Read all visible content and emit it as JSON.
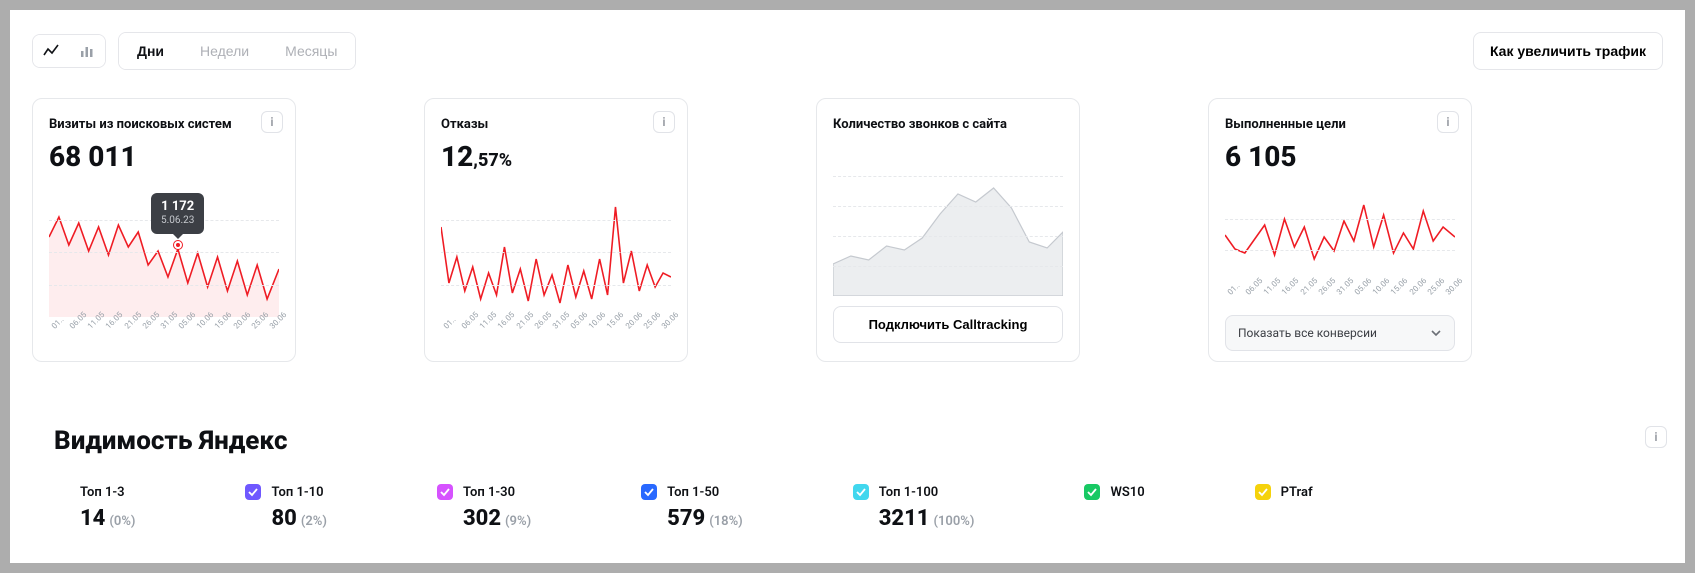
{
  "toolbar": {
    "chart_type": {
      "line_active": true,
      "bar_active": false
    },
    "periods": {
      "days": {
        "label": "Дни",
        "active": true
      },
      "weeks": {
        "label": "Недели",
        "active": false
      },
      "months": {
        "label": "Месяцы",
        "active": false
      }
    },
    "cta_label": "Как увеличить трафик"
  },
  "cards": {
    "visits": {
      "title": "Визиты из поисковых систем",
      "value": "68 011",
      "tooltip": {
        "value": "1 172",
        "date": "5.06.23"
      },
      "x_ticks": [
        "01..",
        "06.05",
        "11.05",
        "16.05",
        "21.05",
        "26.05",
        "31.05",
        "05.06",
        "10.06",
        "15.06",
        "20.06",
        "25.06",
        "30.06"
      ]
    },
    "bounces": {
      "title": "Отказы",
      "value_int": "12",
      "value_frac": ",57%",
      "x_ticks": [
        "01..",
        "06.05",
        "11.05",
        "16.05",
        "21.05",
        "26.05",
        "31.05",
        "05.06",
        "10.06",
        "15.06",
        "20.06",
        "25.06",
        "30.06"
      ]
    },
    "calls": {
      "title": "Количество звонков с сайта",
      "button_label": "Подключить Calltracking"
    },
    "goals": {
      "title": "Выполненные цели",
      "value": "6 105",
      "dropdown_label": "Показать все конверсии",
      "x_ticks": [
        "01..",
        "06.05",
        "11.05",
        "16.05",
        "21.05",
        "26.05",
        "31.05",
        "05.06",
        "10.06",
        "15.06",
        "20.06",
        "25.06",
        "30.06"
      ]
    }
  },
  "visibility": {
    "title": "Видимость Яндекс",
    "items": [
      {
        "label": "Топ 1-3",
        "value": "14",
        "pct": "(0%)",
        "color": "#4b5158"
      },
      {
        "label": "Топ 1-10",
        "value": "80",
        "pct": "(2%)",
        "color": "#6f58ff"
      },
      {
        "label": "Топ 1-30",
        "value": "302",
        "pct": "(9%)",
        "color": "#d652ff"
      },
      {
        "label": "Топ 1-50",
        "value": "579",
        "pct": "(18%)",
        "color": "#2969ff"
      },
      {
        "label": "Топ 1-100",
        "value": "3211",
        "pct": "(100%)",
        "color": "#41d7ee"
      },
      {
        "label": "WS10",
        "value": "",
        "pct": "",
        "color": "#18c964"
      },
      {
        "label": "PTraf",
        "value": "",
        "pct": "",
        "color": "#f5d20b"
      }
    ]
  },
  "chart_data": [
    {
      "type": "line",
      "name": "visits",
      "title": "Визиты из поисковых систем",
      "x": [
        "01.05",
        "06.05",
        "11.05",
        "16.05",
        "21.05",
        "26.05",
        "31.05",
        "05.06",
        "10.06",
        "15.06",
        "20.06",
        "25.06",
        "30.06"
      ],
      "values": [
        1130,
        1240,
        1090,
        1200,
        1050,
        1180,
        1030,
        1190,
        1080,
        1172,
        980,
        1050,
        990,
        1070,
        950,
        1040,
        920,
        1010,
        880,
        990,
        870,
        960,
        850,
        940,
        830
      ],
      "highlight": {
        "x": "05.06",
        "value": 1172,
        "date_label": "5.06.23"
      },
      "ylim_estimate": [
        700,
        1400
      ]
    },
    {
      "type": "line",
      "name": "bounces",
      "title": "Отказы",
      "x": [
        "01.05",
        "06.05",
        "11.05",
        "16.05",
        "21.05",
        "26.05",
        "31.05",
        "05.06",
        "10.06",
        "15.06",
        "20.06",
        "25.06",
        "30.06"
      ],
      "values": [
        16,
        11,
        13,
        10,
        12,
        9,
        11,
        10,
        14,
        10,
        12,
        9,
        13,
        10,
        11,
        9,
        12,
        10,
        18,
        11,
        13,
        10,
        12,
        11,
        12
      ],
      "ylim_estimate": [
        8,
        20
      ],
      "unit": "%"
    },
    {
      "type": "area",
      "name": "calls_placeholder",
      "title": "Количество звонков с сайта",
      "values": [
        20,
        25,
        22,
        30,
        28,
        35,
        48,
        58,
        55,
        60,
        50,
        35,
        30,
        40,
        42
      ],
      "is_placeholder": true
    },
    {
      "type": "line",
      "name": "goals",
      "title": "Выполненные цели",
      "x": [
        "01.05",
        "06.05",
        "11.05",
        "16.05",
        "21.05",
        "26.05",
        "31.05",
        "05.06",
        "10.06",
        "15.06",
        "20.06",
        "25.06",
        "30.06"
      ],
      "values": [
        105,
        95,
        92,
        100,
        112,
        90,
        118,
        95,
        110,
        88,
        104,
        96,
        115,
        100,
        130,
        98,
        120,
        94,
        108,
        96,
        122,
        100,
        110,
        92,
        106
      ],
      "ylim_estimate": [
        80,
        140
      ]
    }
  ]
}
